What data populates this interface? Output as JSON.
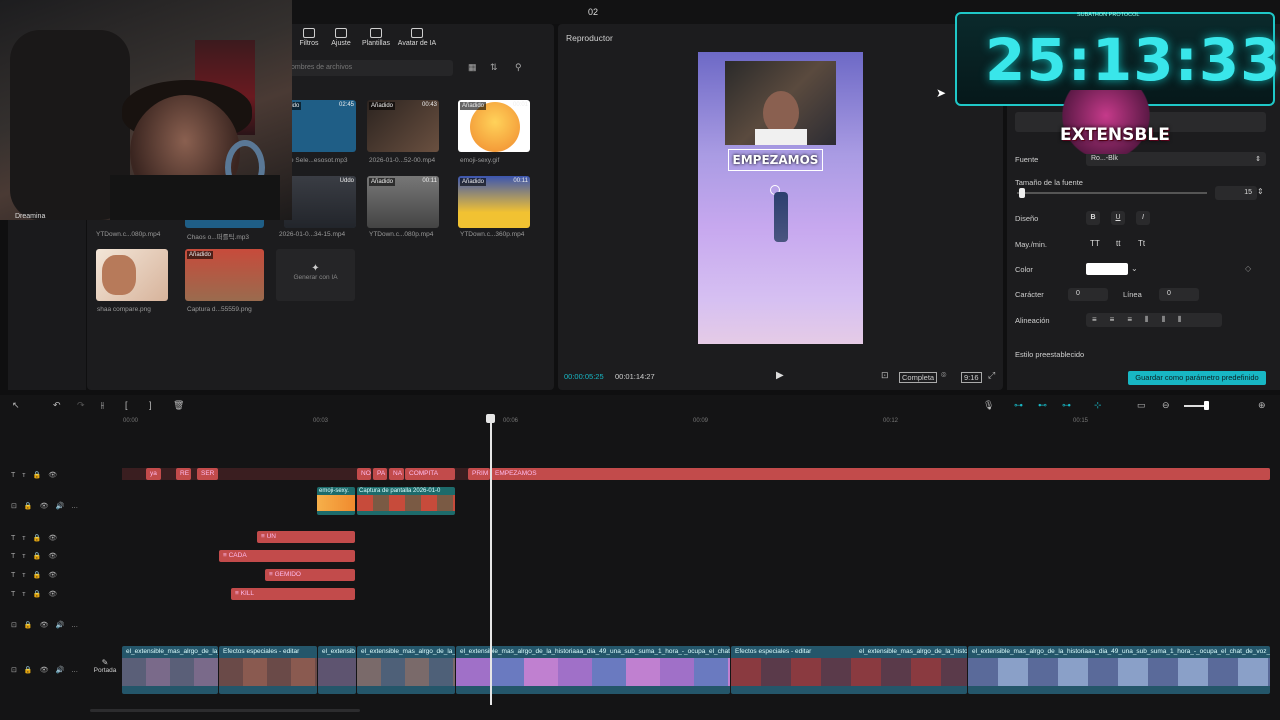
{
  "window": {
    "title": "02"
  },
  "media": {
    "tabs": [
      "Filtros",
      "Ajuste",
      "Plantillas",
      "Avatar de IA"
    ],
    "search_placeholder": "ombres de archivos",
    "sidebar_label": "Dreamina",
    "items": [
      {
        "label": "e Sele...esosot.mp3",
        "badge": "dido",
        "duration": "02:45",
        "color": "#1f5e86"
      },
      {
        "label": "2026-01-0...52-00.mp4",
        "badge": "Añadido",
        "duration": "00:43",
        "color": "#4a3c33"
      },
      {
        "label": "emoji-sexy.gif",
        "badge": "Añadido",
        "duration": "00:01",
        "color": "#f6b04a"
      },
      {
        "label": "YTDown.c...080p.mp4",
        "badge": "dido",
        "duration": "",
        "color": "#2d3440"
      },
      {
        "label": "Chaos o...떠를틱.mp3",
        "badge": "",
        "duration": "",
        "color": "#1f5e86"
      },
      {
        "label": "2026-01-0...34-15.mp4",
        "badge": "",
        "duration": "Uddo",
        "color": "#3a3d44"
      },
      {
        "label": "YTDown.c...080p.mp4",
        "badge": "Añadido",
        "duration": "00:11",
        "color": "#6a6a6a"
      },
      {
        "label": "YTDown.c...360p.mp4",
        "badge": "Añadido",
        "duration": "00:11",
        "color": "#3b56b0"
      },
      {
        "label": "shaa compare.png",
        "badge": "",
        "duration": "",
        "color": "#e9d7c6"
      },
      {
        "label": "Captura d...55559.png",
        "badge": "Añadido",
        "duration": "",
        "color": "#c74b3b"
      }
    ],
    "generate_label": "Generar con IA"
  },
  "player": {
    "title": "Reproductor",
    "overlay_text": "EMPEZAMOS",
    "current_time": "00:00:05:25",
    "total_time": "00:01:14:27",
    "full_label": "Completa",
    "ratio": "9:16"
  },
  "props": {
    "font_label": "Fuente",
    "font_value": "Ro...-Blk",
    "size_label": "Tamaño de la fuente",
    "size_value": "15",
    "design_label": "Diseño",
    "case_label": "May./min.",
    "case_options": [
      "TT",
      "tt",
      "Tt"
    ],
    "color_label": "Color",
    "char_label": "Carácter",
    "char_value": "0",
    "line_label": "Línea",
    "line_value": "0",
    "align_label": "Alineación",
    "preset_label": "Estilo preestablecido",
    "save_preset": "Guardar como parámetro predefinido"
  },
  "overlay": {
    "timer": "25:13:33",
    "caption": "SUBATHON PROTOCOL",
    "logo_text": "EXTENSBLE"
  },
  "webcam": {
    "label": "Dreamina"
  },
  "timeline": {
    "ruler": [
      "00:00",
      "00:03",
      "00:06",
      "00:09",
      "00:12",
      "00:15"
    ],
    "text_clips_row1": [
      "ya",
      "RE",
      "SER",
      "NO",
      "PA",
      "NA",
      "COMPITA",
      "PRIM",
      "EMPEZAMOS"
    ],
    "overlay_clips": [
      "emoji-sexy.",
      "Captura de pantalla 2026-01-0"
    ],
    "text_clips": [
      "UN",
      "CADA",
      "GEMIDO",
      "KILL"
    ],
    "main_clips": [
      "el_extensible_mas_alrgo_de_la_h",
      "Efectos especiales - editar",
      "el_extensib",
      "el_extensible_mas_alrgo_de_la_h",
      "el_extensible_mas_alrgo_de_la_historiaaa_dia_49_una_sub_suma_1_hora_-_ocupa_el_chat_de",
      "Efectos especiales - editar",
      "el_extensible_mas_alrgo_de_la_historiaaa_dia_4",
      "el_extensible_mas_alrgo_de_la_historiaaa_dia_49_una_sub_suma_1_hora_-_ocupa_el_chat_de_voz__ju"
    ],
    "cover_label": "Portada"
  }
}
